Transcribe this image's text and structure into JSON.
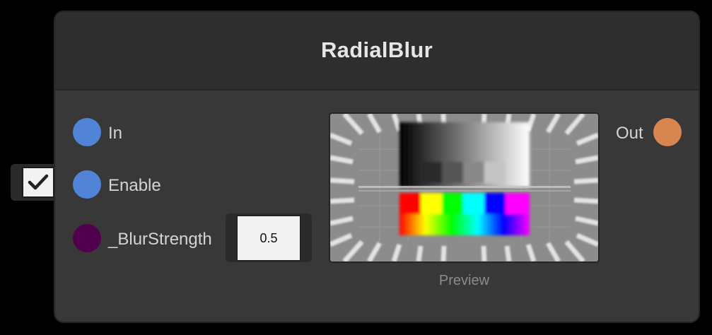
{
  "node": {
    "title": "RadialBlur",
    "inputs": [
      {
        "label": "In",
        "port_color": "#5183d6"
      },
      {
        "label": "Enable",
        "port_color": "#5183d6",
        "toggle_checked": true
      },
      {
        "label": "_BlurStrength",
        "port_color": "#50004f",
        "value": "0.5"
      }
    ],
    "outputs": [
      {
        "label": "Out",
        "port_color": "#d9854f"
      }
    ],
    "preview": {
      "caption": "Preview"
    }
  }
}
